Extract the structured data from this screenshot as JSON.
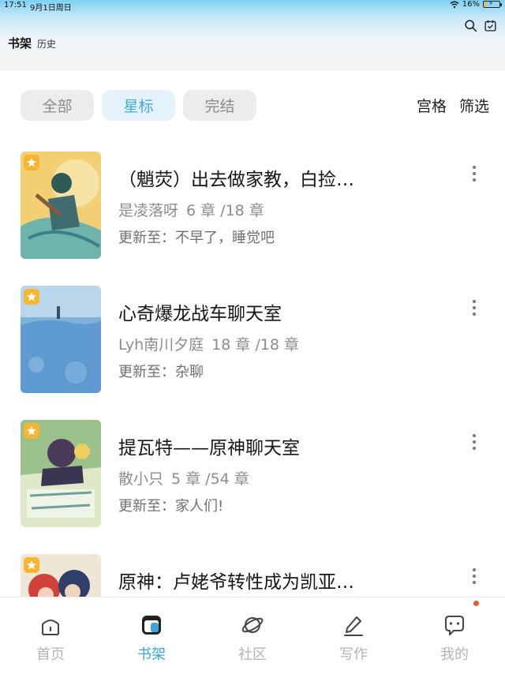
{
  "status_bar": {
    "time": "17:51",
    "date": "9月1日周日",
    "battery": "16%",
    "battery_level": 0.16
  },
  "header": {
    "title": "书架",
    "subtitle": "历史",
    "icons": [
      "search-icon",
      "calendar-check-icon"
    ]
  },
  "filters": {
    "tabs": [
      {
        "label": "全部",
        "active": false
      },
      {
        "label": "星标",
        "active": true
      },
      {
        "label": "完结",
        "active": false
      }
    ],
    "view_options": [
      "宫格",
      "筛选"
    ]
  },
  "books": [
    {
      "title": "（魈荧）出去做家教，白捡…",
      "author": "是凌落呀",
      "progress": "6 章 /18 章",
      "update": "更新至：不早了，睡觉吧",
      "starred": true
    },
    {
      "title": "心奇爆龙战车聊天室",
      "author": "Lyh南川夕庭",
      "progress": "18 章 /18 章",
      "update": "更新至：杂聊",
      "starred": true
    },
    {
      "title": "提瓦特——原神聊天室",
      "author": "散小只",
      "progress": "5 章 /54 章",
      "update": "更新至：家人们!",
      "starred": true
    },
    {
      "title": "原神：卢姥爷转性成为凯亚…",
      "author": "",
      "progress": "",
      "update": "",
      "starred": true
    }
  ],
  "bottom_nav": [
    {
      "label": "首页",
      "icon": "home-icon",
      "active": false
    },
    {
      "label": "书架",
      "icon": "bookshelf-icon",
      "active": true
    },
    {
      "label": "社区",
      "icon": "planet-icon",
      "active": false
    },
    {
      "label": "写作",
      "icon": "pencil-icon",
      "active": false
    },
    {
      "label": "我的",
      "icon": "chat-bubble-icon",
      "active": false,
      "notification": true
    }
  ],
  "colors": {
    "accent": "#3ba6dd",
    "star": "#f7b531",
    "notification": "#e15a3a"
  }
}
